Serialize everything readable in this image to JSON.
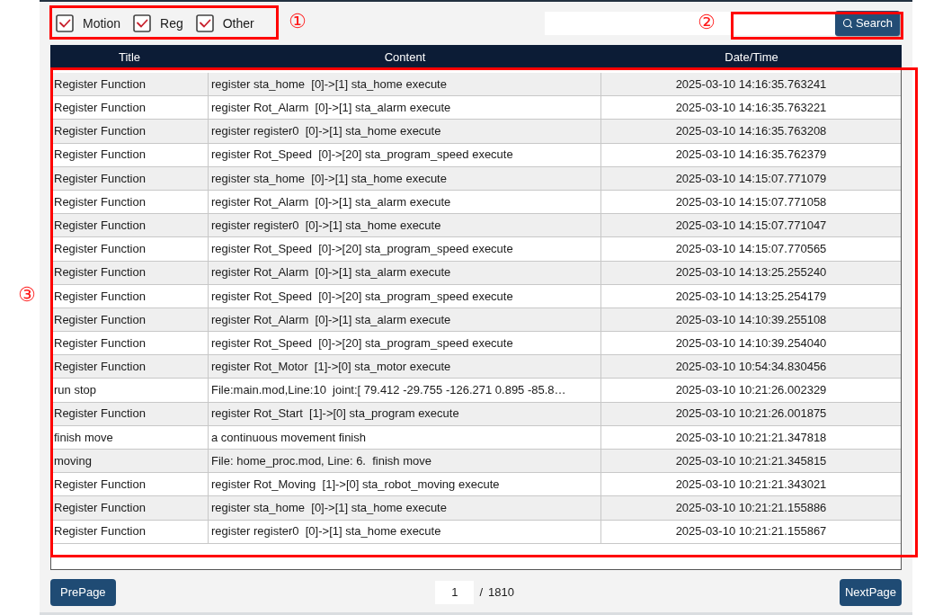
{
  "filters": [
    {
      "label": "Motion",
      "checked": true
    },
    {
      "label": "Reg",
      "checked": true
    },
    {
      "label": "Other",
      "checked": true
    }
  ],
  "search": {
    "button": "Search"
  },
  "table": {
    "columns": [
      "Title",
      "Content",
      "Date/Time"
    ],
    "rows": [
      {
        "title": "Register Function",
        "content": "register sta_home  [0]->[1] sta_home execute",
        "datetime": "2025-03-10 14:16:35.763241"
      },
      {
        "title": "Register Function",
        "content": "register Rot_Alarm  [0]->[1] sta_alarm execute",
        "datetime": "2025-03-10 14:16:35.763221"
      },
      {
        "title": "Register Function",
        "content": "register register0  [0]->[1] sta_home execute",
        "datetime": "2025-03-10 14:16:35.763208"
      },
      {
        "title": "Register Function",
        "content": "register Rot_Speed  [0]->[20] sta_program_speed execute",
        "datetime": "2025-03-10 14:16:35.762379"
      },
      {
        "title": "Register Function",
        "content": "register sta_home  [0]->[1] sta_home execute",
        "datetime": "2025-03-10 14:15:07.771079"
      },
      {
        "title": "Register Function",
        "content": "register Rot_Alarm  [0]->[1] sta_alarm execute",
        "datetime": "2025-03-10 14:15:07.771058"
      },
      {
        "title": "Register Function",
        "content": "register register0  [0]->[1] sta_home execute",
        "datetime": "2025-03-10 14:15:07.771047"
      },
      {
        "title": "Register Function",
        "content": "register Rot_Speed  [0]->[20] sta_program_speed execute",
        "datetime": "2025-03-10 14:15:07.770565"
      },
      {
        "title": "Register Function",
        "content": "register Rot_Alarm  [0]->[1] sta_alarm execute",
        "datetime": "2025-03-10 14:13:25.255240"
      },
      {
        "title": "Register Function",
        "content": "register Rot_Speed  [0]->[20] sta_program_speed execute",
        "datetime": "2025-03-10 14:13:25.254179"
      },
      {
        "title": "Register Function",
        "content": "register Rot_Alarm  [0]->[1] sta_alarm execute",
        "datetime": "2025-03-10 14:10:39.255108"
      },
      {
        "title": "Register Function",
        "content": "register Rot_Speed  [0]->[20] sta_program_speed execute",
        "datetime": "2025-03-10 14:10:39.254040"
      },
      {
        "title": "Register Function",
        "content": "register Rot_Motor  [1]->[0] sta_motor execute",
        "datetime": "2025-03-10 10:54:34.830456"
      },
      {
        "title": "run stop",
        "content": "File:main.mod,Line:10  joint:[ 79.412 -29.755 -126.271 0.895 -85.8…",
        "datetime": "2025-03-10 10:21:26.002329"
      },
      {
        "title": "Register Function",
        "content": "register Rot_Start  [1]->[0] sta_program execute",
        "datetime": "2025-03-10 10:21:26.001875"
      },
      {
        "title": "finish move",
        "content": "a continuous movement finish",
        "datetime": "2025-03-10 10:21:21.347818"
      },
      {
        "title": "moving",
        "content": "File: home_proc.mod, Line: 6.  finish move",
        "datetime": "2025-03-10 10:21:21.345815"
      },
      {
        "title": "Register Function",
        "content": "register Rot_Moving  [1]->[0] sta_robot_moving execute",
        "datetime": "2025-03-10 10:21:21.343021"
      },
      {
        "title": "Register Function",
        "content": "register sta_home  [0]->[1] sta_home execute",
        "datetime": "2025-03-10 10:21:21.155886"
      },
      {
        "title": "Register Function",
        "content": "register register0  [0]->[1] sta_home execute",
        "datetime": "2025-03-10 10:21:21.155867"
      }
    ]
  },
  "pagination": {
    "prev": "PrePage",
    "page": "1",
    "separator": "/",
    "total": "1810",
    "next": "NextPage"
  },
  "annotations": [
    {
      "label": "①"
    },
    {
      "label": "②"
    },
    {
      "label": "③"
    }
  ]
}
